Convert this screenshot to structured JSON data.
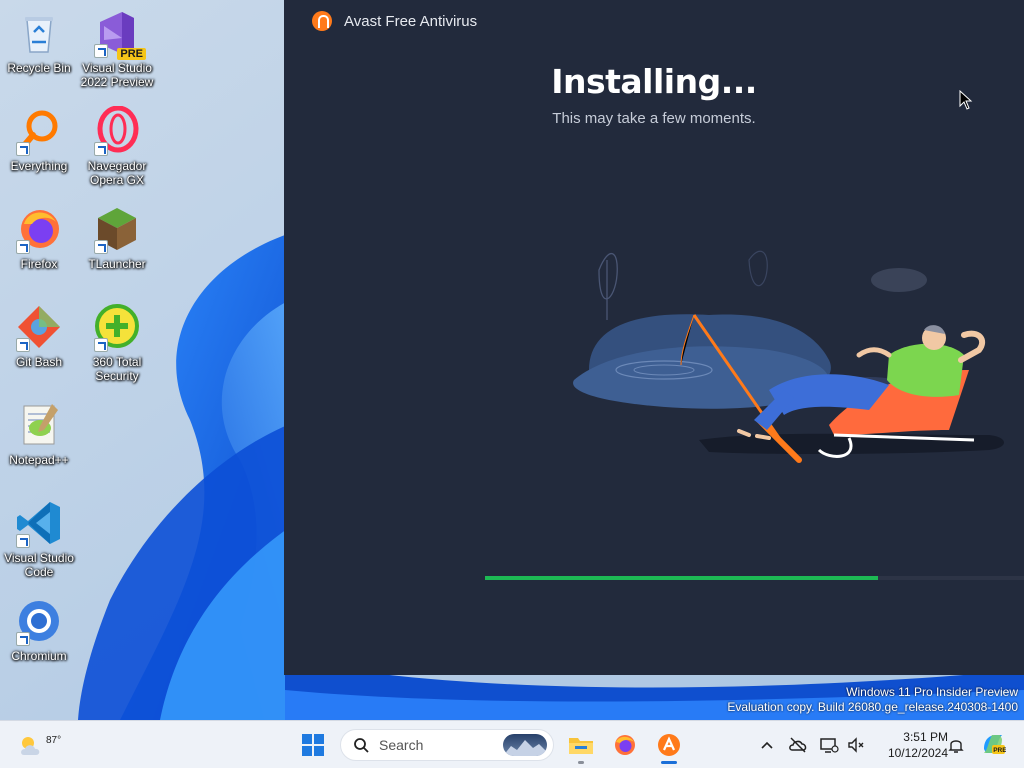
{
  "desktop": {
    "icons": [
      {
        "label": "Recycle Bin",
        "icon": "recycle-bin-icon"
      },
      {
        "label": "Visual Studio 2022 Preview",
        "icon": "visual-studio-icon",
        "badge": "PRE"
      },
      {
        "label": "Everything",
        "icon": "everything-search-icon"
      },
      {
        "label": "Navegador Opera GX",
        "icon": "opera-gx-icon"
      },
      {
        "label": "Firefox",
        "icon": "firefox-icon"
      },
      {
        "label": "TLauncher",
        "icon": "tlauncher-icon"
      },
      {
        "label": "Git Bash",
        "icon": "git-bash-icon"
      },
      {
        "label": "360 Total Security",
        "icon": "360-security-icon"
      },
      {
        "label": "Notepad++",
        "icon": "notepad-plus-plus-icon"
      },
      {
        "label": "Visual Studio Code",
        "icon": "vscode-icon"
      },
      {
        "label": "Chromium",
        "icon": "chromium-icon"
      }
    ]
  },
  "avast": {
    "window_title": "Avast Free Antivirus",
    "heading": "Installing...",
    "subheading": "This may take a few moments.",
    "progress": 0.73,
    "colors": {
      "background": "#222a3c",
      "progress": "#1db954",
      "brand": "#ff7a1a"
    }
  },
  "watermark": {
    "line1": "Windows 11 Pro Insider Preview",
    "line2": "Evaluation copy. Build 26080.ge_release.240308-1400"
  },
  "taskbar": {
    "weather_temp": "87°",
    "search_placeholder": "Search",
    "apps": [
      "start-icon",
      "file-explorer-icon",
      "firefox-icon",
      "avast-icon"
    ],
    "tray": [
      "chevron-up-icon",
      "onedrive-icon",
      "network-icon",
      "volume-icon",
      "notifications-icon",
      "copilot-icon"
    ],
    "clock_time": "3:51 PM",
    "clock_date": "10/12/2024"
  }
}
